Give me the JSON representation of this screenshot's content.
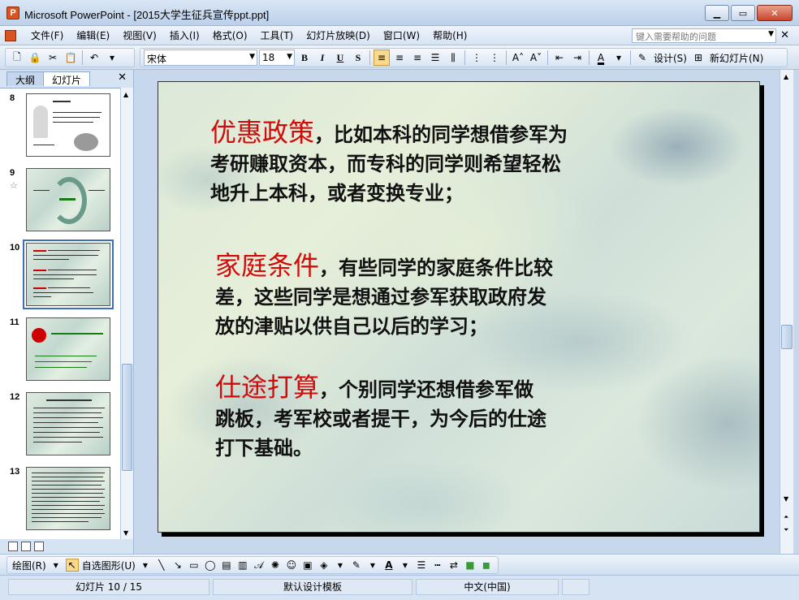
{
  "window": {
    "title": "Microsoft PowerPoint - [2015大学生征兵宣传ppt.ppt]"
  },
  "menu": {
    "items": [
      "文件(F)",
      "编辑(E)",
      "视图(V)",
      "插入(I)",
      "格式(O)",
      "工具(T)",
      "幻灯片放映(D)",
      "窗口(W)",
      "帮助(H)"
    ],
    "help_placeholder": "键入需要帮助的问题"
  },
  "toolbar": {
    "font_name": "宋体",
    "font_size": "18",
    "design_label": "设计(S)",
    "new_slide_label": "新幻灯片(N)",
    "accent_color": "#f9d98b"
  },
  "pane": {
    "tabs": [
      "大纲",
      "幻灯片"
    ],
    "selected_tab": "幻灯片",
    "slides": [
      {
        "number": "8"
      },
      {
        "number": "9",
        "has_animation": true
      },
      {
        "number": "10",
        "selected": true
      },
      {
        "number": "11"
      },
      {
        "number": "12"
      },
      {
        "number": "13"
      }
    ]
  },
  "slide": {
    "paragraphs": [
      {
        "heading": "优惠政策",
        "lines": [
          "，比如本科的同学想借参军为",
          "考研赚取资本，而专科的同学则希望轻松",
          "地升上本科，或者变换专业；"
        ]
      },
      {
        "heading": "家庭条件",
        "lines": [
          "，有些同学的家庭条件比较",
          "差，这些同学是想通过参军获取政府发",
          "放的津贴以供自己以后的学习；"
        ]
      },
      {
        "heading": "仕途打算",
        "lines": [
          "，个别同学还想借参军做",
          "跳板，考军校或者提干，为今后的仕途",
          "打下基础。"
        ]
      }
    ],
    "heading_color": "#d20a0a"
  },
  "drawing": {
    "draw_label": "绘图(R)",
    "autoshape_label": "自选图形(U)"
  },
  "status": {
    "slide_position": "幻灯片 10 / 15",
    "template": "默认设计模板",
    "language": "中文(中国)"
  }
}
